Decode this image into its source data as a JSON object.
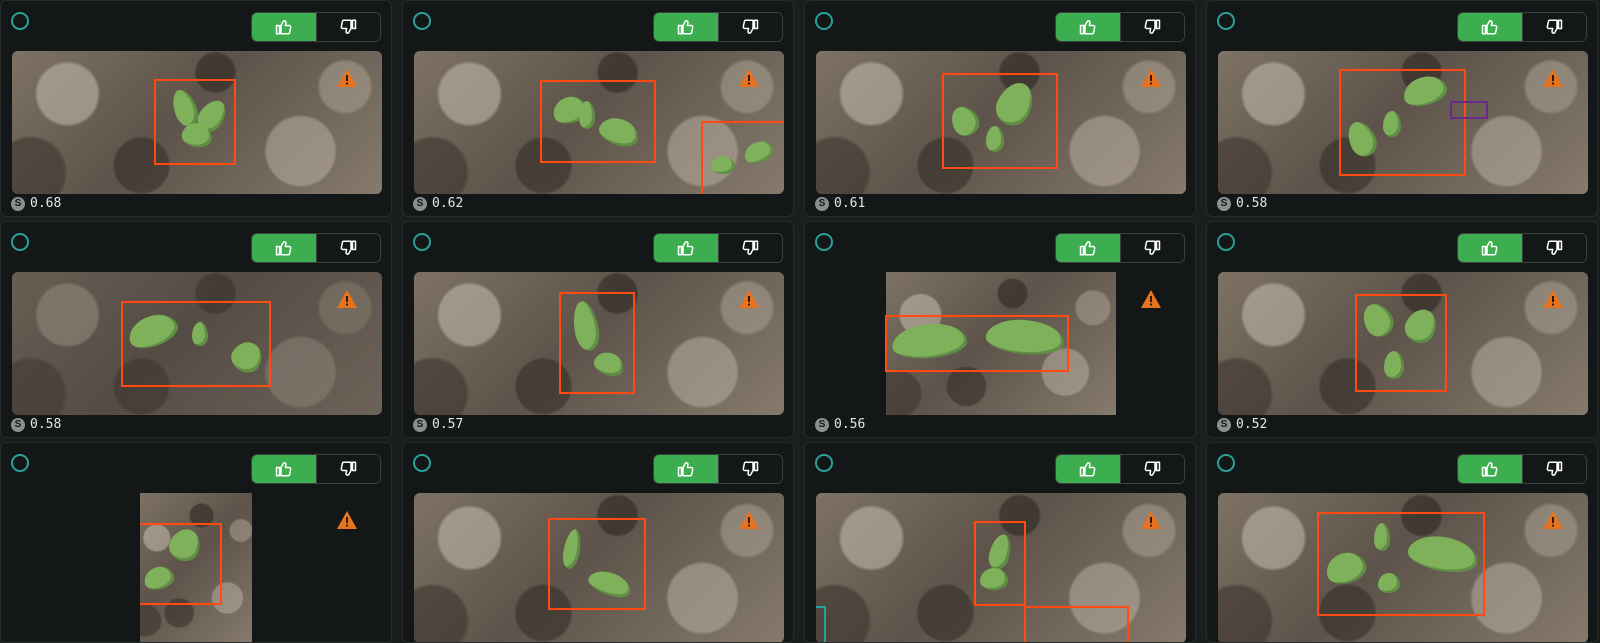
{
  "colors": {
    "accent_green": "#3cae4f",
    "box_orange": "#ff4a12",
    "warning_orange": "#e8731f",
    "select_teal": "#2aa198"
  },
  "icons": {
    "select": "circle-outline-icon",
    "vote_up": "thumbs-up-icon",
    "vote_down": "thumbs-down-icon",
    "warning": "warning-triangle-icon",
    "score_badge": "score-s-icon"
  },
  "score_badge_letter": "S",
  "cards": [
    {
      "score": "0.68"
    },
    {
      "score": "0.62"
    },
    {
      "score": "0.61"
    },
    {
      "score": "0.58"
    },
    {
      "score": "0.58"
    },
    {
      "score": "0.57"
    },
    {
      "score": "0.56"
    },
    {
      "score": "0.52"
    },
    {
      "score": ""
    },
    {
      "score": ""
    },
    {
      "score": ""
    },
    {
      "score": ""
    }
  ]
}
